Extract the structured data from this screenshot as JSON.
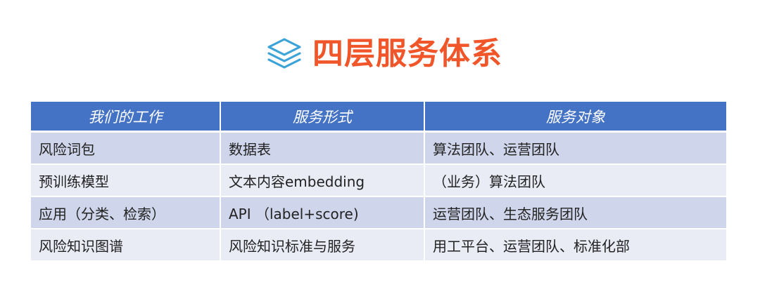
{
  "header": {
    "icon": "layers-icon",
    "title": "四层服务体系",
    "title_color": "#f0562a",
    "icon_color": "#3ca3d8"
  },
  "table": {
    "header_color": "#4472c4",
    "row_color_odd": "#cfd5ea",
    "row_color_even": "#e9ebf5",
    "columns": [
      "我们的工作",
      "服务形式",
      "服务对象"
    ],
    "rows": [
      [
        "风险词包",
        "数据表",
        "算法团队、运营团队"
      ],
      [
        "预训练模型",
        "文本内容embedding",
        "（业务）算法团队"
      ],
      [
        "应用（分类、检索）",
        "API （label+score)",
        "运营团队、生态服务团队"
      ],
      [
        "风险知识图谱",
        "风险知识标准与服务",
        "用工平台、运营团队、标准化部"
      ]
    ]
  }
}
